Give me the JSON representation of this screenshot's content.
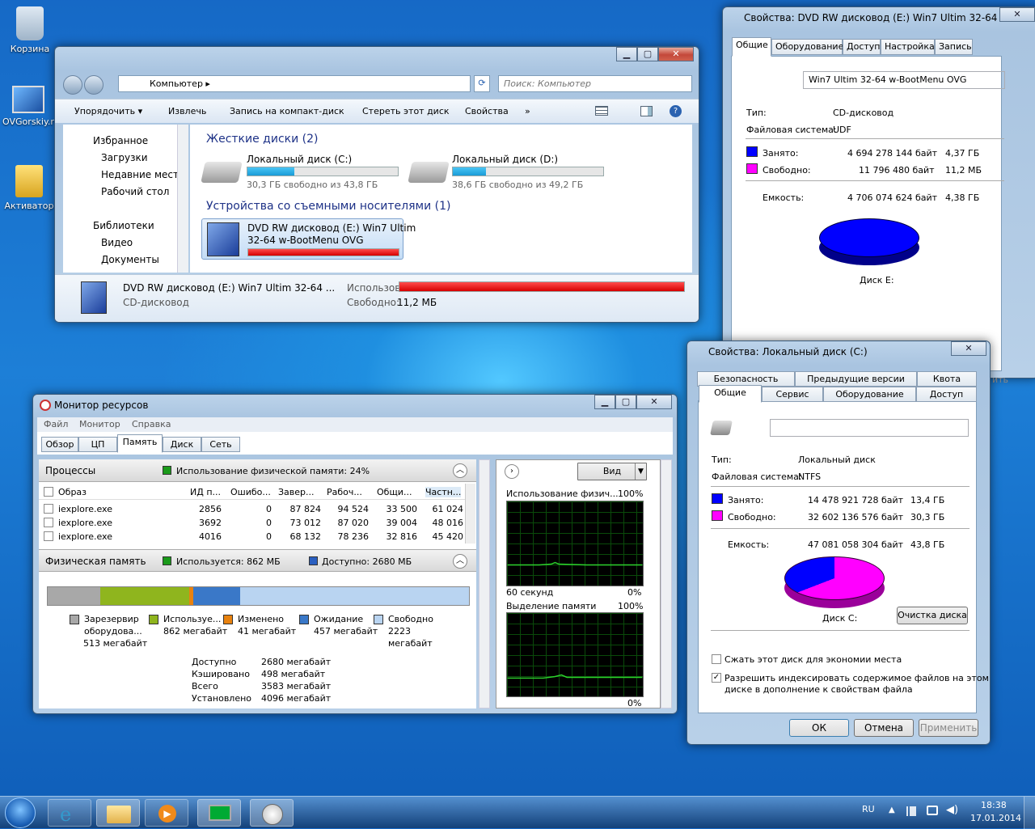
{
  "desktop": {
    "recycle": "Корзина",
    "site": "OVGorskiy.r",
    "activator": "Активатор"
  },
  "explorer": {
    "address": "Компьютер",
    "search_placeholder": "Поиск: Компьютер",
    "toolbar": [
      "Упорядочить ▾",
      "Извлечь",
      "Запись на компакт-диск",
      "Стереть этот диск",
      "Свойства",
      "»"
    ],
    "nav": {
      "fav": "Избранное",
      "downloads": "Загрузки",
      "recent": "Недавние места",
      "desktop": "Рабочий стол",
      "libs": "Библиотеки",
      "video": "Видео",
      "docs": "Документы"
    },
    "group1": "Жесткие диски (2)",
    "disk_c": {
      "name": "Локальный диск (C:)",
      "free": "30,3 ГБ свободно из 43,8 ГБ",
      "fill": 0.31
    },
    "disk_d": {
      "name": "Локальный диск (D:)",
      "free": "38,6 ГБ свободно из 49,2 ГБ",
      "fill": 0.22
    },
    "group2": "Устройства со съемными носителями (1)",
    "dvd": {
      "line1": "DVD RW дисковод (E:) Win7 Ultim",
      "line2": "32-64 w-BootMenu OVG",
      "fill": 1.0
    },
    "details": {
      "title": "DVD RW дисковод (E:) Win7 Ultim 32-64 ...",
      "type": "CD-дисковод",
      "used_label": "Использовано:",
      "free_label": "Свободно:",
      "free_value": "11,2 МБ"
    }
  },
  "dvdprops": {
    "title": "Свойства: DVD RW дисковод (E:) Win7 Ultim 32-64 ...",
    "tabs": [
      "Общие",
      "Оборудование",
      "Доступ",
      "Настройка",
      "Запись"
    ],
    "label": "Win7 Ultim 32-64 w-BootMenu OVG",
    "type_l": "Тип:",
    "type_v": "CD-дисковод",
    "fs_l": "Файловая система:",
    "fs_v": "UDF",
    "used_l": "Занято:",
    "used_b": "4 694 278 144 байт",
    "used_h": "4,37 ГБ",
    "free_l": "Свободно:",
    "free_b": "11 796 480 байт",
    "free_h": "11,2 МБ",
    "cap_l": "Емкость:",
    "cap_b": "4 706 074 624 байт",
    "cap_h": "4,38 ГБ",
    "disk": "Диск E:",
    "used_color": "#0000ff",
    "free_color": "#ff00ff"
  },
  "cprops": {
    "title": "Свойства: Локальный диск (C:)",
    "tabs_top": [
      "Безопасность",
      "Предыдущие версии",
      "Квота"
    ],
    "tabs_bot": [
      "Общие",
      "Сервис",
      "Оборудование",
      "Доступ"
    ],
    "type_l": "Тип:",
    "type_v": "Локальный диск",
    "fs_l": "Файловая система:",
    "fs_v": "NTFS",
    "used_l": "Занято:",
    "used_b": "14 478 921 728 байт",
    "used_h": "13,4 ГБ",
    "free_l": "Свободно:",
    "free_b": "32 602 136 576 байт",
    "free_h": "30,3 ГБ",
    "cap_l": "Емкость:",
    "cap_b": "47 081 058 304 байт",
    "cap_h": "43,8 ГБ",
    "disk": "Диск C:",
    "cleanup": "Очистка диска",
    "compress": "Сжать этот диск для экономии места",
    "index1": "Разрешить индексировать содержимое файлов на этом",
    "index2": "диске в дополнение к свойствам файла",
    "ok": "ОК",
    "cancel": "Отмена",
    "apply": "Применить",
    "behind_apply": "ить"
  },
  "resmon": {
    "title": "Монитор ресурсов",
    "menu": [
      "Файл",
      "Монитор",
      "Справка"
    ],
    "tabs": [
      "Обзор",
      "ЦП",
      "Память",
      "Диск",
      "Сеть"
    ],
    "proc_title": "Процессы",
    "proc_usage": "Использование физической памяти: 24%",
    "cols": [
      "Образ",
      "ИД п...",
      "Ошибо...",
      "Завер...",
      "Рабоч...",
      "Общи...",
      "Частн..."
    ],
    "rows": [
      [
        "iexplore.exe",
        "2856",
        "0",
        "87 824",
        "94 524",
        "33 500",
        "61 024"
      ],
      [
        "iexplore.exe",
        "3692",
        "0",
        "73 012",
        "87 020",
        "39 004",
        "48 016"
      ],
      [
        "iexplore.exe",
        "4016",
        "0",
        "68 132",
        "78 236",
        "32 816",
        "45 420"
      ]
    ],
    "phys_title": "Физическая память",
    "phys_used": "Используется: 862 МБ",
    "phys_avail": "Доступно: 2680 МБ",
    "legend": [
      [
        "Зарезервир",
        "оборудова...",
        "513 мегабайт"
      ],
      [
        "Используе...",
        "862 мегабайт",
        ""
      ],
      [
        "Изменено",
        "41 мегабайт",
        ""
      ],
      [
        "Ожидание",
        "457 мегабайт",
        ""
      ],
      [
        "Свободно",
        "2223",
        "мегабайт"
      ]
    ],
    "stats": [
      [
        "Доступно",
        "2680 мегабайт"
      ],
      [
        "Кэшировано",
        "498 мегабайт"
      ],
      [
        "Всего",
        "3583 мегабайт"
      ],
      [
        "Установлено",
        "4096 мегабайт"
      ]
    ],
    "view": "Вид",
    "g1_title": "Использование физич...",
    "g1_max": "100%",
    "g1_x": "60 секунд",
    "g1_min": "0%",
    "g2_title": "Выделение памяти",
    "g2_max": "100%",
    "g2_min": "0%"
  },
  "taskbar": {
    "lang": "RU",
    "time": "18:38",
    "date": "17.01.2014"
  }
}
